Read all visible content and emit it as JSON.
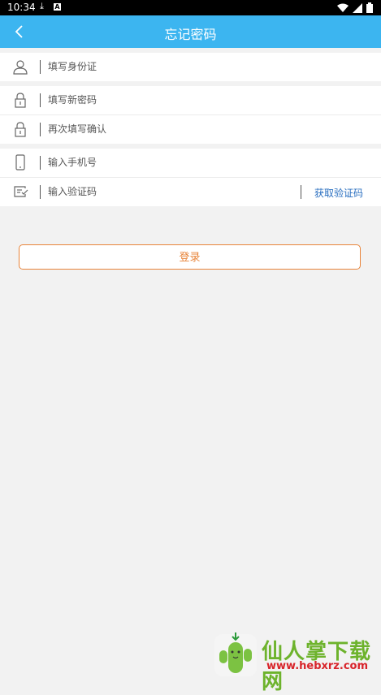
{
  "status_bar": {
    "time": "10:34",
    "notification_letter": "A"
  },
  "header": {
    "title": "忘记密码",
    "back_icon": "chevron-left-icon",
    "bg_color": "#3cb5f0"
  },
  "form": {
    "id_card": {
      "placeholder": "填写身份证",
      "icon": "user-icon"
    },
    "new_password": {
      "placeholder": "填写新密码",
      "icon": "lock-icon"
    },
    "confirm_password": {
      "placeholder": "再次填写确认",
      "icon": "lock-icon"
    },
    "phone": {
      "placeholder": "输入手机号",
      "icon": "phone-icon"
    },
    "code": {
      "placeholder": "输入验证码",
      "icon": "code-icon",
      "get_code_label": "获取验证码"
    }
  },
  "login_button": {
    "label": "登录",
    "accent_color": "#e8843a"
  },
  "watermark": {
    "name": "仙人掌下载网",
    "url": "www.hebxrz.com"
  }
}
